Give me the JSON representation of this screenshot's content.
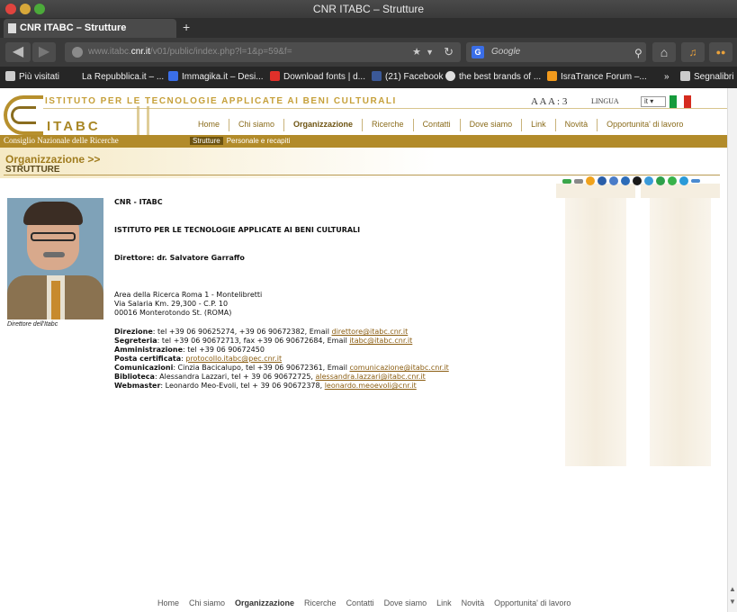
{
  "window": {
    "title": "CNR ITABC – Strutture"
  },
  "tab": {
    "label": "CNR ITABC – Strutture",
    "new_tab": "+"
  },
  "nav": {
    "url_prefix": "www.itabc.",
    "url_host": "cnr.it",
    "url_rest": "/v01/public/index.php?l=1&p=59&f=",
    "search_placeholder": "Google",
    "search_engine_badge": "G"
  },
  "bookmarks": [
    {
      "label": "Più visitati",
      "icon_color": "#cccccc"
    },
    {
      "label": "La Repubblica.it – ...",
      "icon_color": ""
    },
    {
      "label": "Immagika.it – Desi...",
      "icon_color": "#3a6ee8"
    },
    {
      "label": "Download fonts | d...",
      "icon_color": "#e0302a"
    },
    {
      "label": "(21) Facebook",
      "icon_color": "#3b5998"
    },
    {
      "label": "the best brands of ...",
      "icon_color": "#dddddd"
    },
    {
      "label": "IsraTrance Forum –...",
      "icon_color": "#f29a1c"
    },
    {
      "label": "»",
      "icon_color": ""
    },
    {
      "label": "Segnalibri",
      "icon_color": "#cccccc"
    }
  ],
  "site": {
    "institute_name": "ISTITUTO PER LE TECNOLOGIE APPLICATE AI BENI CULTURALI",
    "logo_text": "ITABC",
    "cnr_label": "Consiglio Nazionale delle Ricerche",
    "text_size": "A A A : 3",
    "lingua_label": "LINGUA",
    "lang_value": "it",
    "flag_colors": [
      "#169b3c",
      "#ffffff",
      "#d52b1e"
    ],
    "main_nav": [
      "Home",
      "Chi siamo",
      "Organizzazione",
      "Ricerche",
      "Contatti",
      "Dove siamo",
      "Link",
      "Novità",
      "Opportunita' di lavoro"
    ],
    "main_nav_active": "Organizzazione",
    "sub_nav": [
      "Strutture",
      "Personale e recapiti"
    ],
    "accent_gold": "#b28b2a",
    "link_color": "#8a5c10"
  },
  "breadcrumb": {
    "title": "Organizzazione >>",
    "subtitle": "STRUTTURE"
  },
  "share_icons": [
    "#3aa64a",
    "#888888",
    "#f0a21c",
    "#2a5ea8",
    "#4a7cc8",
    "#2c6cb8",
    "#1a1a1a",
    "#3a9ad8",
    "#2ea04a",
    "#38b24a",
    "#2a9ad8",
    "#4a8ad0"
  ],
  "portrait": {
    "caption": "Direttore dell'Itabc"
  },
  "content": {
    "org": "CNR - ITABC",
    "institute": "ISTITUTO PER LE TECNOLOGIE APPLICATE AI BENI CULTURALI",
    "director": "Direttore: dr. Salvatore Garraffo",
    "address1": "Area della Ricerca Roma 1 - Montelibretti",
    "address2": "Via Salaria Km. 29,300 - C.P. 10",
    "address3": "00016 Monterotondo St. (ROMA)",
    "contacts": [
      {
        "label": "Direzione",
        "text": ": tel +39 06 90625274, +39 06 90672382,  Email ",
        "link": "direttore@itabc.cnr.it"
      },
      {
        "label": "Segreteria",
        "text": ": tel +39 06 90672713, fax +39 06 90672684, Email ",
        "link": "itabc@itabc.cnr.it"
      },
      {
        "label": "Amministrazione",
        "text": ": tel +39 06 90672450",
        "link": ""
      },
      {
        "label": "Posta certificata",
        "text": ": ",
        "link": "protocollo.itabc@pec.cnr.it"
      },
      {
        "label": "Comunicazioni",
        "text": ": Cinzia Bacicalupo, tel +39 06 90672361, Email ",
        "link": "comunicazione@itabc.cnr.it"
      },
      {
        "label": "Biblioteca",
        "text": ": Alessandra Lazzari, tel + 39 06 90672725, ",
        "link": "alessandra.lazzari@itabc.cnr.it"
      },
      {
        "label": "Webmaster",
        "text": ": Leonardo Meo-Evoli, tel + 39 06 90672378, ",
        "link": "leonardo.meoevoli@cnr.it"
      }
    ]
  },
  "footer_nav": [
    "Home",
    "Chi siamo",
    "Organizzazione",
    "Ricerche",
    "Contatti",
    "Dove siamo",
    "Link",
    "Novità",
    "Opportunita' di lavoro"
  ],
  "footer_nav_active": "Organizzazione"
}
